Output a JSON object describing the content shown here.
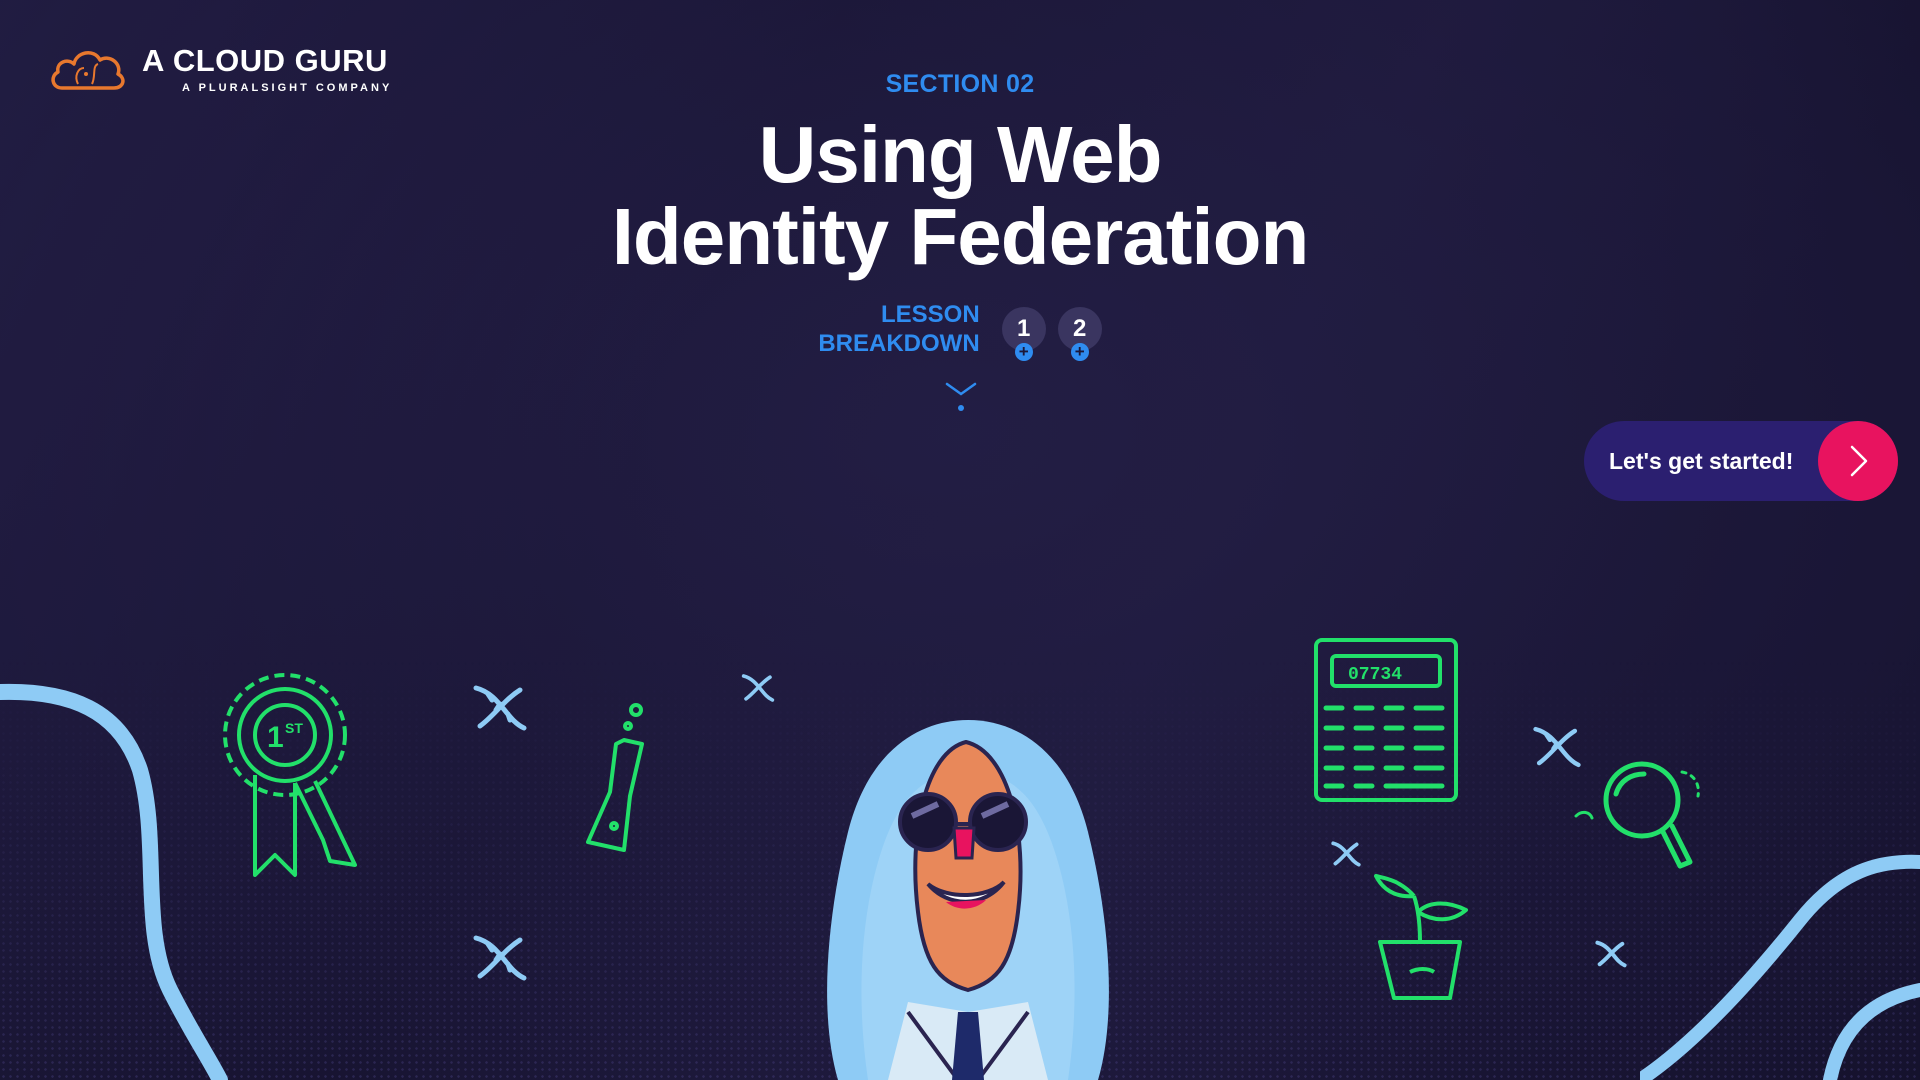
{
  "logo": {
    "title": "A CLOUD GURU",
    "subtitle": "A PLURALSIGHT COMPANY",
    "icon": "cloud-icon",
    "color": "#e8782e"
  },
  "header": {
    "section_label": "SECTION 02",
    "title_line1": "Using Web",
    "title_line2": "Identity Federation"
  },
  "lesson_breakdown": {
    "label_line1": "LESSON",
    "label_line2": "BREAKDOWN",
    "lessons": [
      {
        "number": "1"
      },
      {
        "number": "2"
      }
    ]
  },
  "cta": {
    "label": "Let's get started!",
    "icon": "chevron-right-icon"
  },
  "colors": {
    "background": "#1c1838",
    "accent_blue": "#2f8cf0",
    "accent_pink": "#e8135f",
    "cta_bg": "#2b1f70",
    "doodle_green": "#22e06a",
    "doodle_lightblue": "#8ecbf5",
    "logo_orange": "#e8782e"
  },
  "illustrations": {
    "calculator_display": "07734"
  }
}
